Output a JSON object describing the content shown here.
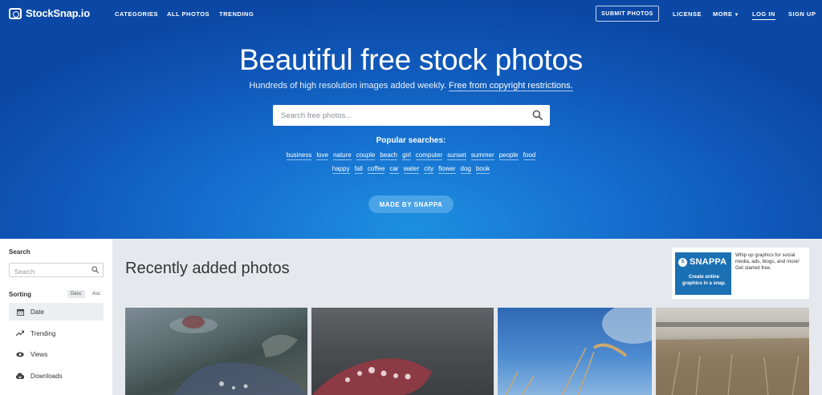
{
  "nav": {
    "logo": "StockSnap.io",
    "categories": "CATEGORIES",
    "all_photos": "ALL PHOTOS",
    "trending": "TRENDING",
    "submit": "SUBMIT PHOTOS",
    "license": "LICENSE",
    "more": "MORE",
    "login": "LOG IN",
    "signup": "SIGN UP"
  },
  "hero": {
    "title": "Beautiful free stock photos",
    "subtitle": "Hundreds of high resolution images added weekly.",
    "subtitle_link": "Free from copyright restrictions.",
    "search_placeholder": "Search free photos...",
    "popular_title": "Popular searches:",
    "tags_row1": [
      "business",
      "love",
      "nature",
      "couple",
      "beach",
      "girl",
      "computer",
      "sunset",
      "summer",
      "people",
      "food"
    ],
    "tags_row2": [
      "happy",
      "fall",
      "coffee",
      "car",
      "water",
      "city",
      "flower",
      "dog",
      "book"
    ],
    "made_by": "MADE BY SNAPPA"
  },
  "sidebar": {
    "search_label": "Search",
    "search_placeholder": "Search",
    "sorting_label": "Sorting",
    "desc": "Desc",
    "asc": "Asc",
    "items": [
      {
        "label": "Date",
        "icon": "calendar-icon",
        "active": true
      },
      {
        "label": "Trending",
        "icon": "trending-icon",
        "active": false
      },
      {
        "label": "Views",
        "icon": "eye-icon",
        "active": false
      },
      {
        "label": "Downloads",
        "icon": "download-icon",
        "active": false
      }
    ]
  },
  "main": {
    "title": "Recently added photos"
  },
  "ad": {
    "logo_letter": "S",
    "logo": "SNAPPA",
    "tagline": "Create online graphics in a snap.",
    "text": "Whip up graphics for social media, ads, blogs, and more! Get started free."
  },
  "colors": {
    "hero_blue": "#1670cf",
    "button_blue": "#4aa3e6",
    "ad_blue": "#1b6fb3"
  }
}
